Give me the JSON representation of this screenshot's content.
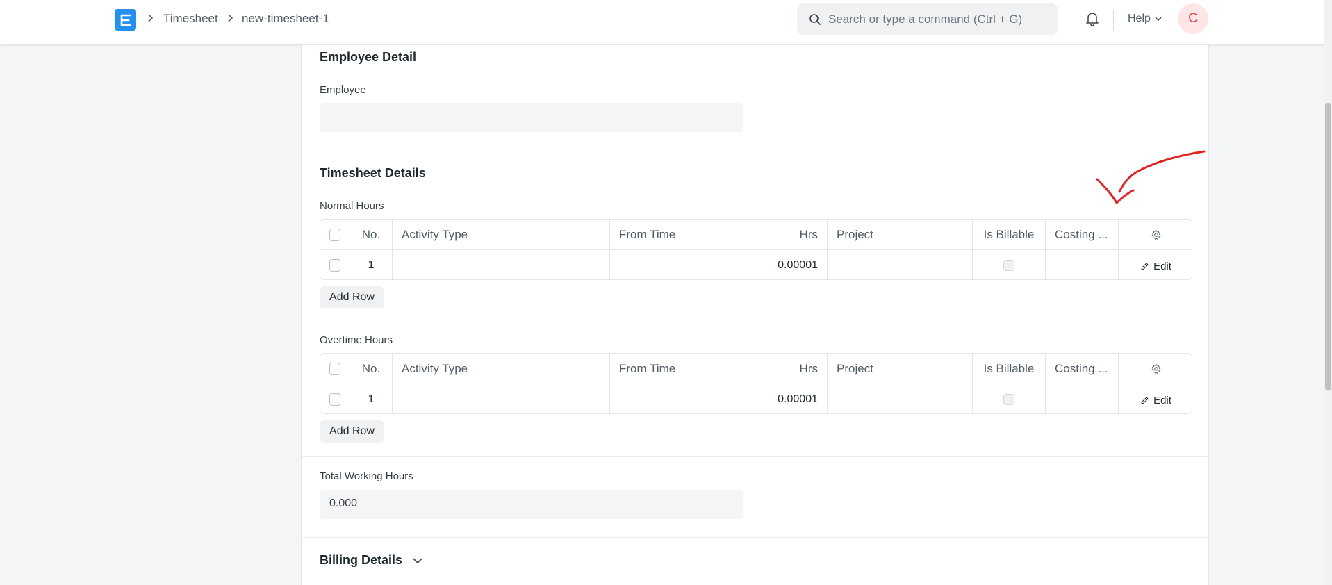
{
  "navbar": {
    "breadcrumbs": [
      "Timesheet",
      "new-timesheet-1"
    ],
    "search_placeholder": "Search or type a command (Ctrl + G)",
    "help_label": "Help",
    "avatar_initial": "C",
    "logo_letter": "E"
  },
  "employee_section": {
    "title": "Employee Detail",
    "employee_label": "Employee",
    "employee_value": ""
  },
  "timesheet_section": {
    "title": "Timesheet Details",
    "normal_hours": {
      "label": "Normal Hours",
      "columns": [
        "No.",
        "Activity Type",
        "From Time",
        "Hrs",
        "Project",
        "Is Billable",
        "Costing ..."
      ],
      "rows": [
        {
          "no": "1",
          "activity_type": "",
          "from_time": "",
          "hrs": "0.00001",
          "project": "",
          "is_billable": false,
          "costing": ""
        }
      ],
      "edit_label": "Edit",
      "add_row_label": "Add Row"
    },
    "overtime_hours": {
      "label": "Overtime Hours",
      "columns": [
        "No.",
        "Activity Type",
        "From Time",
        "Hrs",
        "Project",
        "Is Billable",
        "Costing ..."
      ],
      "rows": [
        {
          "no": "1",
          "activity_type": "",
          "from_time": "",
          "hrs": "0.00001",
          "project": "",
          "is_billable": false,
          "costing": ""
        }
      ],
      "edit_label": "Edit",
      "add_row_label": "Add Row"
    },
    "total_label": "Total Working Hours",
    "total_value": "0.000"
  },
  "billing_section": {
    "title": "Billing Details"
  },
  "colors": {
    "brand": "#2490ef",
    "annotation": "#e02424",
    "avatar_bg": "#ffe6e6",
    "avatar_fg": "#e24c4c"
  },
  "icons": {
    "search": "search-icon",
    "bell": "bell-icon",
    "gear": "gear-icon",
    "edit": "pencil-icon",
    "chevron": "chevron-down-icon"
  }
}
